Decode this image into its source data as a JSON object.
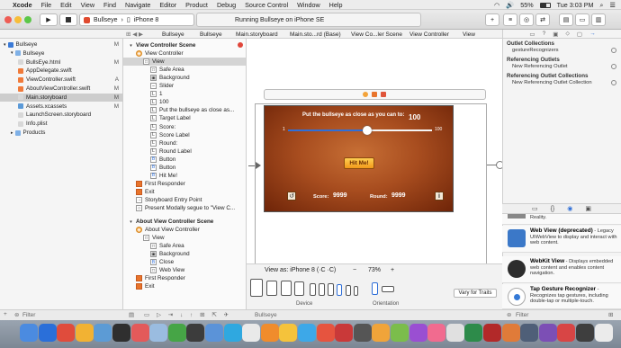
{
  "menubar": {
    "app": "Xcode",
    "items": [
      "File",
      "Edit",
      "View",
      "Find",
      "Navigate",
      "Editor",
      "Product",
      "Debug",
      "Source Control",
      "Window",
      "Help"
    ],
    "battery": "55%",
    "clock": "Tue 3:03 PM"
  },
  "toolbar": {
    "scheme": "Bullseye",
    "device": "iPhone 8",
    "status": "Running Bullseye on iPhone SE"
  },
  "jumpbar": [
    "Bullseye",
    "Bullseye",
    "Main.storyboard",
    "Main.sto...rd (Base)",
    "View Co...ler Scene",
    "View Controller",
    "View"
  ],
  "navigator": {
    "items": [
      {
        "label": "Bullseye",
        "status": "M",
        "level": 0,
        "kind": "project"
      },
      {
        "label": "Bullseye",
        "status": "",
        "level": 1,
        "kind": "folder"
      },
      {
        "label": "BullsEye.html",
        "status": "M",
        "level": 2,
        "kind": "file"
      },
      {
        "label": "AppDelegate.swift",
        "status": "",
        "level": 2,
        "kind": "swift"
      },
      {
        "label": "ViewController.swift",
        "status": "A",
        "level": 2,
        "kind": "swift"
      },
      {
        "label": "AboutViewController.swift",
        "status": "M",
        "level": 2,
        "kind": "swift"
      },
      {
        "label": "Main.storyboard",
        "status": "M",
        "level": 2,
        "kind": "file",
        "selected": true
      },
      {
        "label": "Assets.xcassets",
        "status": "M",
        "level": 2,
        "kind": "asset"
      },
      {
        "label": "LaunchScreen.storyboard",
        "status": "",
        "level": 2,
        "kind": "file"
      },
      {
        "label": "Info.plist",
        "status": "",
        "level": 2,
        "kind": "file"
      },
      {
        "label": "Products",
        "status": "",
        "level": 1,
        "kind": "folder"
      }
    ]
  },
  "outline": {
    "items": [
      {
        "label": "View Controller Scene",
        "level": 0,
        "glyph": "▾",
        "bold": true
      },
      {
        "label": "View Controller",
        "level": 1,
        "glyph": "◉"
      },
      {
        "label": "View",
        "level": 2,
        "glyph": "□",
        "selected": true
      },
      {
        "label": "Safe Area",
        "level": 3,
        "glyph": "□"
      },
      {
        "label": "Background",
        "level": 3,
        "glyph": "▣"
      },
      {
        "label": "Slider",
        "level": 3,
        "glyph": "‒"
      },
      {
        "label": "1",
        "level": 3,
        "glyph": "L"
      },
      {
        "label": "100",
        "level": 3,
        "glyph": "L"
      },
      {
        "label": "Put the bullseye as close as...",
        "level": 3,
        "glyph": "L"
      },
      {
        "label": "Target Label",
        "level": 3,
        "glyph": "L"
      },
      {
        "label": "Score:",
        "level": 3,
        "glyph": "L"
      },
      {
        "label": "Score Label",
        "level": 3,
        "glyph": "L"
      },
      {
        "label": "Round:",
        "level": 3,
        "glyph": "L"
      },
      {
        "label": "Round Label",
        "level": 3,
        "glyph": "L"
      },
      {
        "label": "Button",
        "level": 3,
        "glyph": "B"
      },
      {
        "label": "Button",
        "level": 3,
        "glyph": "B"
      },
      {
        "label": "Hit Me!",
        "level": 3,
        "glyph": "B"
      },
      {
        "label": "First Responder",
        "level": 1,
        "glyph": "■"
      },
      {
        "label": "Exit",
        "level": 1,
        "glyph": "■"
      },
      {
        "label": "Storyboard Entry Point",
        "level": 1,
        "glyph": "→"
      },
      {
        "label": "Present Modally segue to \"View C...",
        "level": 1,
        "glyph": "○"
      },
      {
        "label": "About View Controller Scene",
        "level": 0,
        "glyph": "▾",
        "bold": true
      },
      {
        "label": "About View Controller",
        "level": 1,
        "glyph": "◉"
      },
      {
        "label": "View",
        "level": 2,
        "glyph": "□"
      },
      {
        "label": "Safe Area",
        "level": 3,
        "glyph": "□"
      },
      {
        "label": "Background",
        "level": 3,
        "glyph": "▣"
      },
      {
        "label": "Close",
        "level": 3,
        "glyph": "B"
      },
      {
        "label": "Web View",
        "level": 3,
        "glyph": "□"
      },
      {
        "label": "First Responder",
        "level": 1,
        "glyph": "■"
      },
      {
        "label": "Exit",
        "level": 1,
        "glyph": "■"
      }
    ]
  },
  "scene": {
    "instruction": "Put the bullseye as close as you can to:",
    "target": "100",
    "slider_min": "1",
    "slider_max": "100",
    "slider_value": 0.55,
    "hit_me": "Hit Me!",
    "score_label": "Score:",
    "score_value": "9999",
    "round_label": "Round:",
    "round_value": "9999",
    "info": "i"
  },
  "canvasbar": {
    "view_as": "View as: iPhone 8 (·C ·C)",
    "zoom": "73%",
    "device_label": "Device",
    "orientation_label": "Orientation",
    "vary": "Vary for Traits"
  },
  "inspector": {
    "sections": [
      {
        "title": "Outlet Collections",
        "rows": [
          "gestureRecognizers"
        ]
      },
      {
        "title": "Referencing Outlets",
        "rows": [
          "New Referencing Outlet"
        ]
      },
      {
        "title": "Referencing Outlet Collections",
        "rows": [
          "New Referencing Outlet Collection"
        ]
      }
    ]
  },
  "library": {
    "partial": "Reality.",
    "items": [
      {
        "title": "Web View (deprecated)",
        "desc": " - Legacy UIWebView to display and interact with web content.",
        "icon_color": "#3b78c8"
      },
      {
        "title": "WebKit View",
        "desc": " - Displays embedded web content and enables content navigation.",
        "icon_color": "#2d2d2d"
      },
      {
        "title": "Tap Gesture Recognizer",
        "desc": " - Recognizes tap gestures, including double-tap or multiple-touch.",
        "icon_color": "#3479d6"
      }
    ]
  },
  "bottombar": {
    "filter_left": "Filter",
    "scheme_name": "Bullseye",
    "filter_right": "Filter"
  },
  "dock": {
    "colors": [
      "#4b8be0",
      "#2a6fd9",
      "#e04c3c",
      "#f2b233",
      "#5c9bd5",
      "#2f2f2f",
      "#e35a5a",
      "#9abce0",
      "#46a546",
      "#3c3c3c",
      "#5b93d8",
      "#2fa8e0",
      "#e9e9e9",
      "#f08c2c",
      "#f5c33b",
      "#3da8e8",
      "#e6543f",
      "#c93939",
      "#555555",
      "#f0a43a",
      "#7bbd4b",
      "#9a4fd2",
      "#f16b8f",
      "#e0e0e0",
      "#2d8b4a",
      "#b22929",
      "#e07b39",
      "#4f5f78",
      "#7c4fb5",
      "#d84545",
      "#3e3e3e",
      "#ebebeb"
    ]
  }
}
